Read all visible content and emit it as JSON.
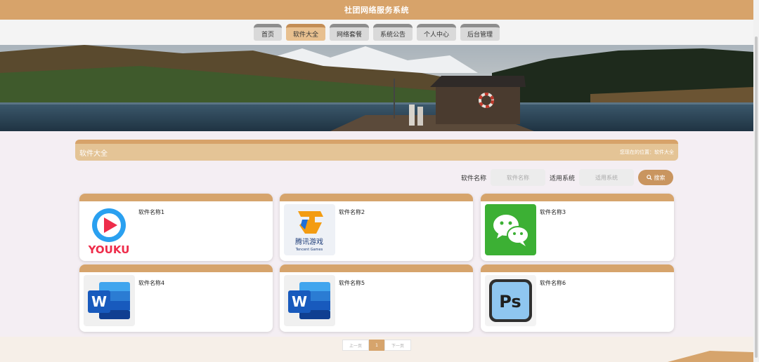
{
  "header": {
    "title": "社团网络服务系统"
  },
  "nav": {
    "tabs": [
      {
        "label": "首页",
        "active": false
      },
      {
        "label": "软件大全",
        "active": true
      },
      {
        "label": "网络套餐",
        "active": false
      },
      {
        "label": "系统公告",
        "active": false
      },
      {
        "label": "个人中心",
        "active": false
      },
      {
        "label": "后台管理",
        "active": false
      }
    ]
  },
  "section": {
    "title": "软件大全",
    "breadcrumb": "您现在的位置：软件大全"
  },
  "search": {
    "name_label": "软件名称",
    "name_placeholder": "软件名称",
    "system_label": "适用系统",
    "system_placeholder": "适用系统",
    "button_label": "搜索"
  },
  "software": [
    {
      "name": "软件名称1",
      "icon": "youku-icon"
    },
    {
      "name": "软件名称2",
      "icon": "tencent-games-icon"
    },
    {
      "name": "软件名称3",
      "icon": "wechat-icon"
    },
    {
      "name": "软件名称4",
      "icon": "word-icon"
    },
    {
      "name": "软件名称5",
      "icon": "word-icon"
    },
    {
      "name": "软件名称6",
      "icon": "photoshop-icon"
    }
  ],
  "icon_text": {
    "youku": "YOUKU",
    "tencent_cn": "腾讯游戏",
    "tencent_en": "Tencent Games",
    "word": "W",
    "ps": "Ps"
  },
  "pagination": {
    "prev": "上一页",
    "current": "1",
    "next": "下一页"
  },
  "colors": {
    "accent": "#d7a36a",
    "accent_light": "#e4c496",
    "button": "#c9955f"
  }
}
